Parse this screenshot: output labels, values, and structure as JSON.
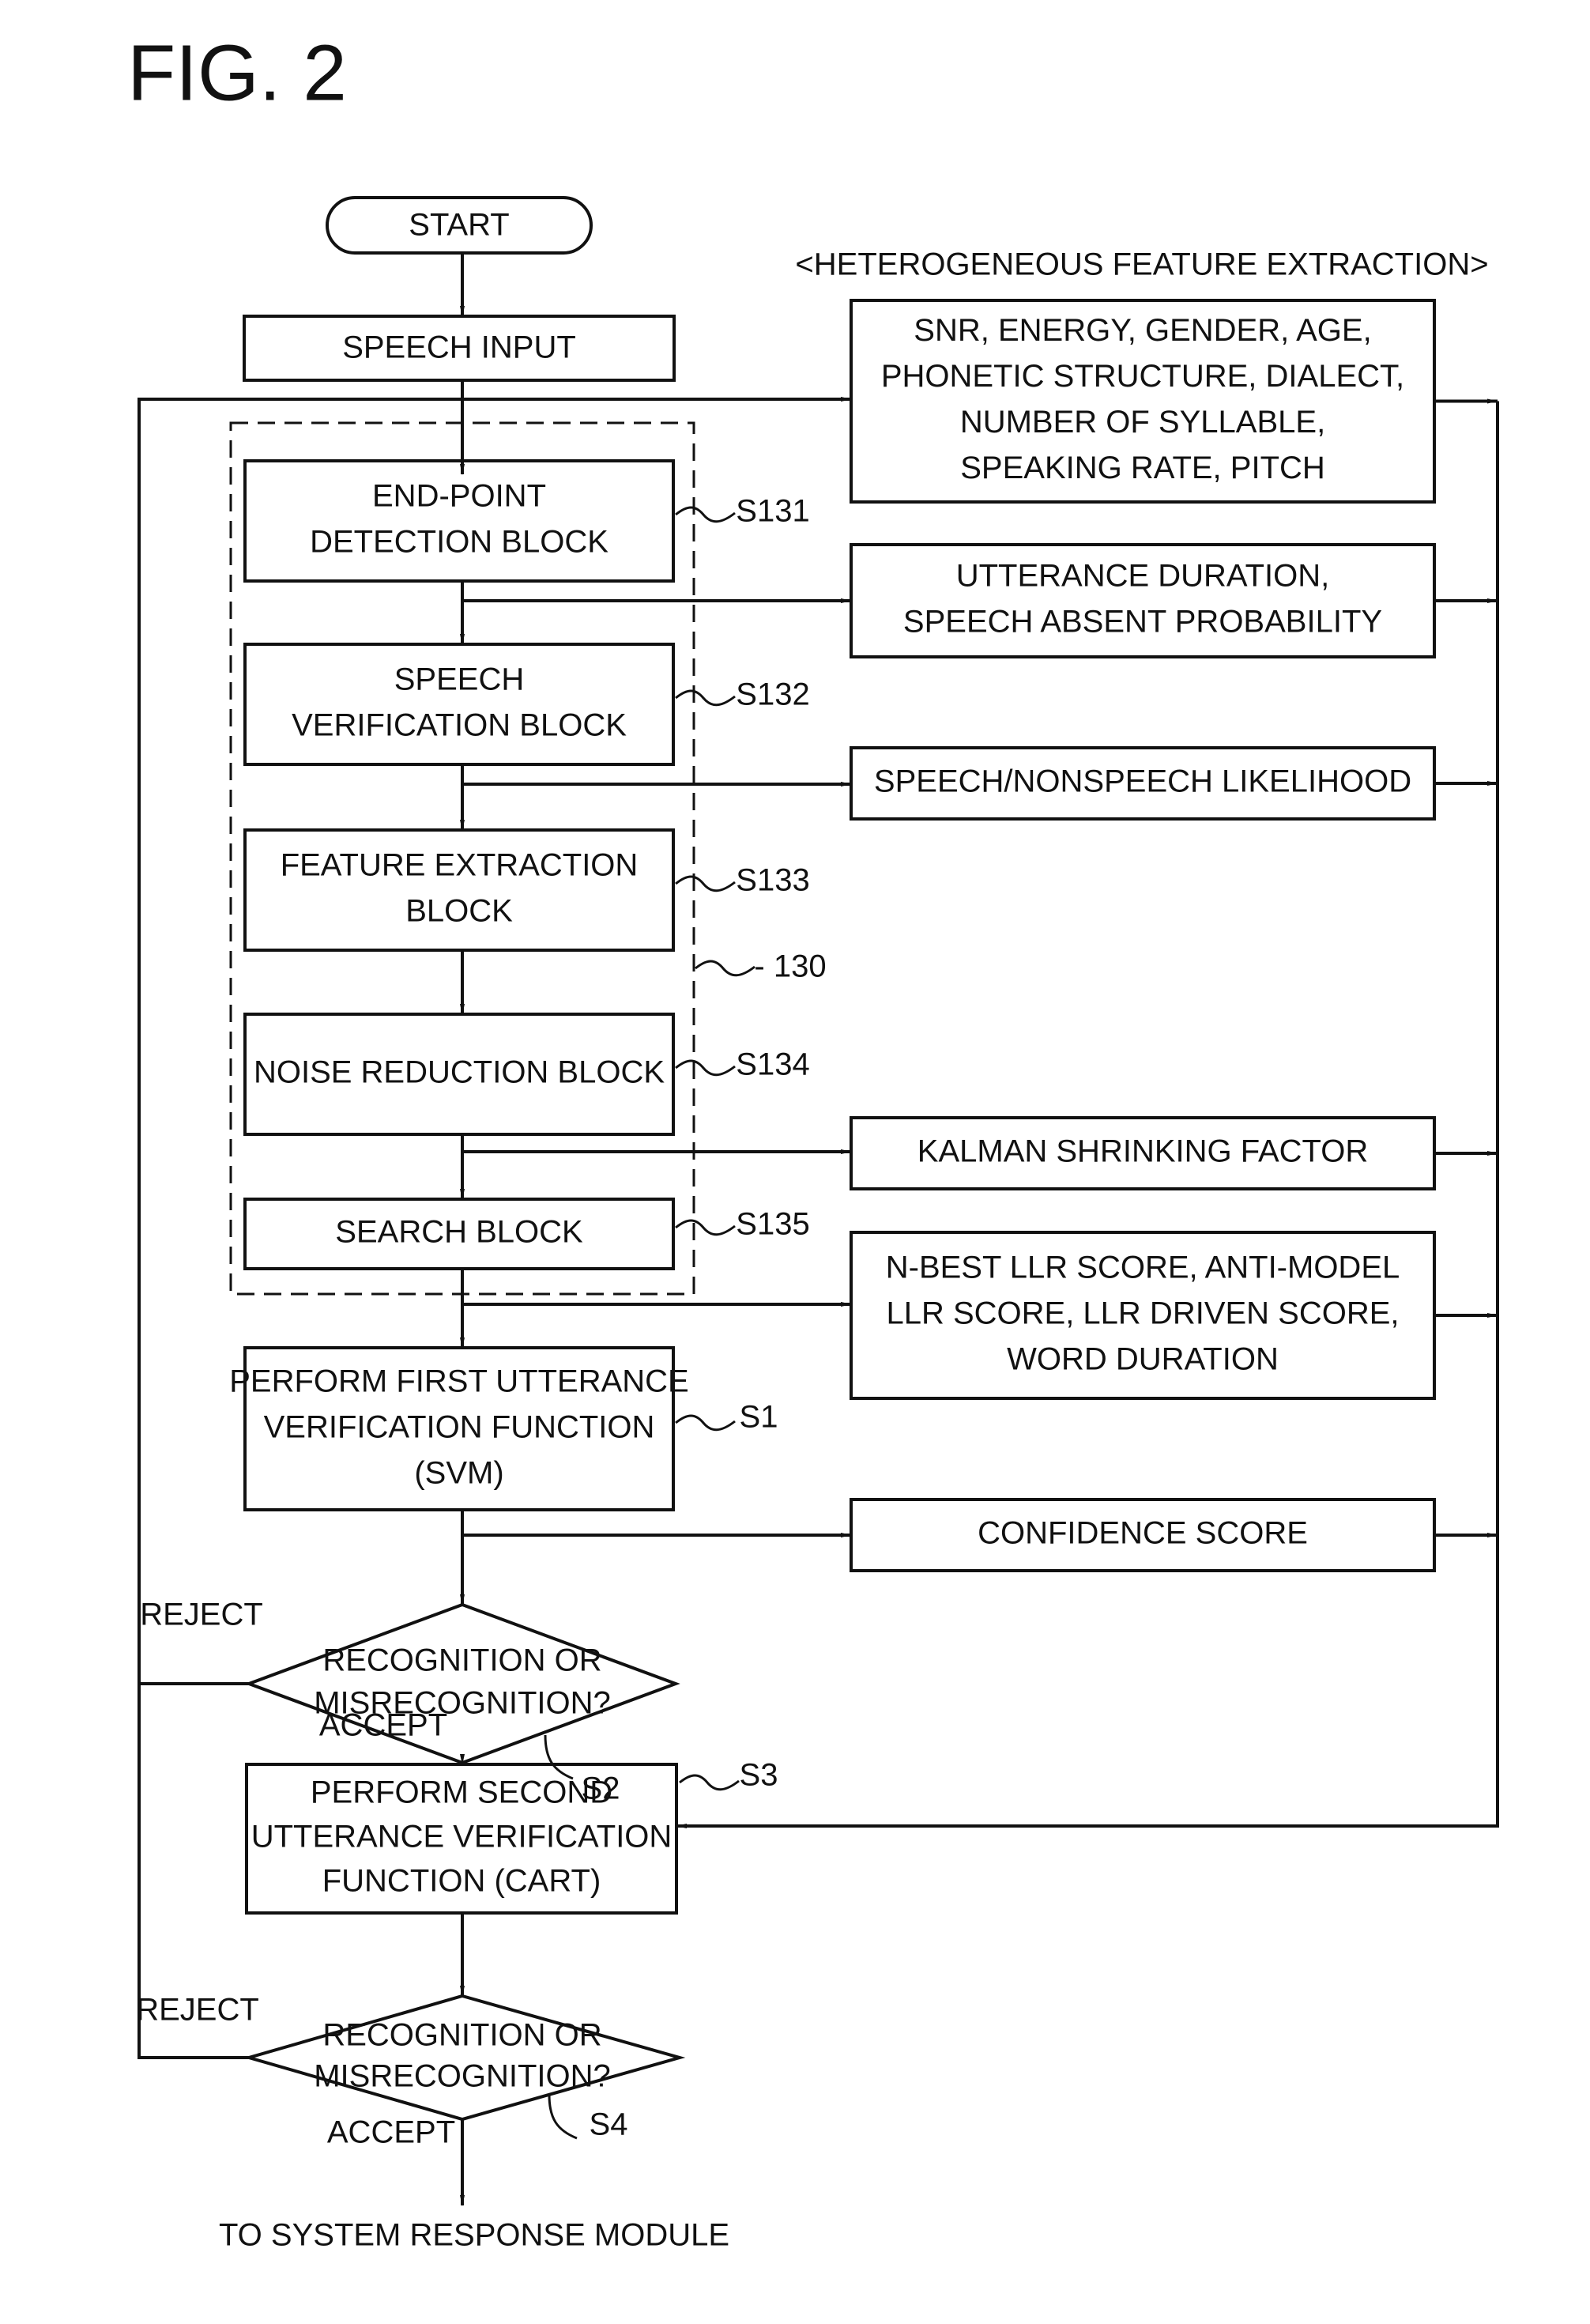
{
  "figure_title": "FIG. 2",
  "start": "START",
  "speech_input": "SPEECH INPUT",
  "group_label": "130",
  "blocks": [
    {
      "lines": [
        "END-POINT",
        "DETECTION BLOCK"
      ],
      "ref": "S131"
    },
    {
      "lines": [
        "SPEECH",
        "VERIFICATION BLOCK"
      ],
      "ref": "S132"
    },
    {
      "lines": [
        "FEATURE EXTRACTION",
        "BLOCK"
      ],
      "ref": "S133"
    },
    {
      "lines": [
        "NOISE REDUCTION BLOCK"
      ],
      "ref": "S134"
    },
    {
      "lines": [
        "SEARCH BLOCK"
      ],
      "ref": "S135"
    }
  ],
  "svm": {
    "lines": [
      "PERFORM FIRST UTTERANCE",
      "VERIFICATION FUNCTION",
      "(SVM)"
    ],
    "ref": "S1"
  },
  "decision1": {
    "lines": [
      "RECOGNITION OR",
      "MISRECOGNITION?"
    ],
    "ref": "S2",
    "reject": "REJECT",
    "accept": "ACCEPT"
  },
  "cart": {
    "lines": [
      "PERFORM SECOND",
      "UTTERANCE VERIFICATION",
      "FUNCTION (CART)"
    ],
    "ref": "S3"
  },
  "decision2": {
    "lines": [
      "RECOGNITION OR",
      "MISRECOGNITION?"
    ],
    "ref": "S4",
    "reject": "REJECT",
    "accept": "ACCEPT"
  },
  "end_text": "TO SYSTEM RESPONSE MODULE",
  "features": {
    "title": "<HETEROGENEOUS FEATURE EXTRACTION>",
    "boxes": [
      {
        "lines": [
          "SNR, ENERGY, GENDER, AGE,",
          "PHONETIC STRUCTURE, DIALECT,",
          "NUMBER OF SYLLABLE,",
          "SPEAKING RATE, PITCH"
        ]
      },
      {
        "lines": [
          "UTTERANCE DURATION,",
          "SPEECH ABSENT PROBABILITY"
        ]
      },
      {
        "lines": [
          "SPEECH/NONSPEECH LIKELIHOOD"
        ]
      },
      {
        "lines": [
          "KALMAN SHRINKING FACTOR"
        ]
      },
      {
        "lines": [
          "N-BEST LLR SCORE, ANTI-MODEL",
          "LLR SCORE, LLR DRIVEN SCORE,",
          "WORD DURATION"
        ]
      },
      {
        "lines": [
          "CONFIDENCE SCORE"
        ]
      }
    ]
  }
}
